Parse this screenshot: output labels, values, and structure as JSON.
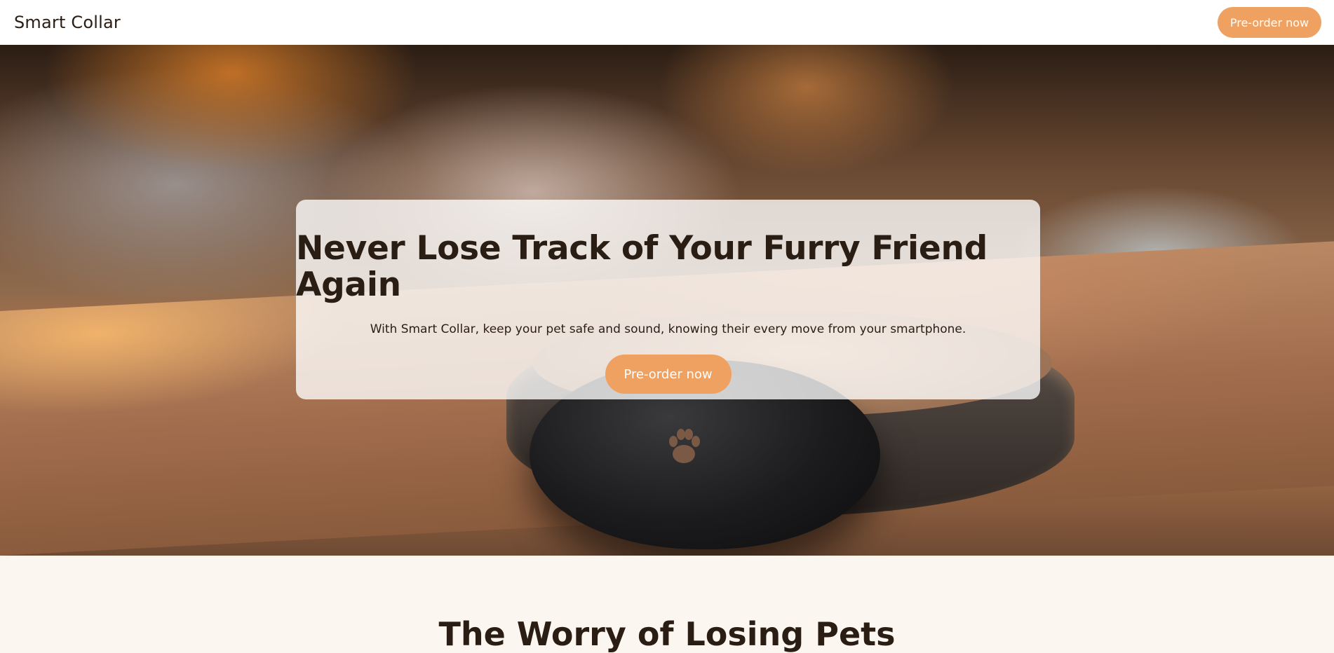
{
  "header": {
    "brand": "Smart Collar",
    "cta_label": "Pre-order now"
  },
  "hero": {
    "title": "Never Lose Track of Your Furry Friend Again",
    "subtitle": "With Smart Collar, keep your pet safe and sound, knowing their every move from your smartphone.",
    "cta_label": "Pre-order now",
    "image_icon": "paw-icon"
  },
  "next_section": {
    "title": "The Worry of Losing Pets"
  },
  "colors": {
    "accent": "#efa161",
    "text": "#2a1d14",
    "page_bg": "#fcf6f1"
  }
}
